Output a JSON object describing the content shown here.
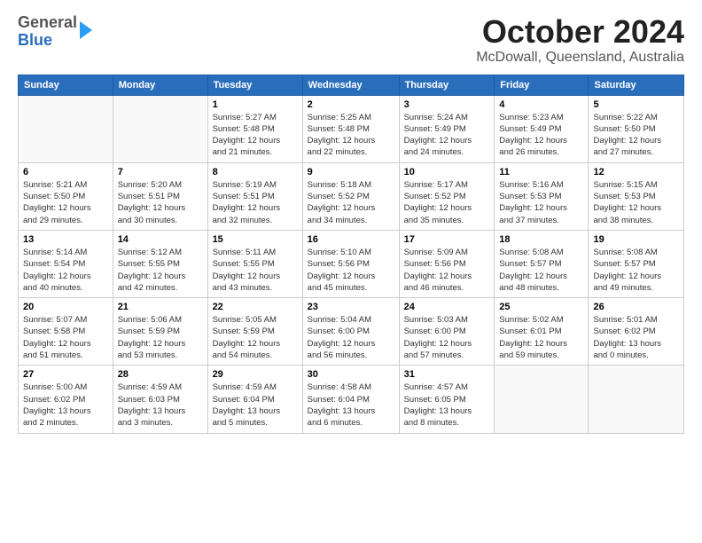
{
  "logo": {
    "general": "General",
    "blue": "Blue"
  },
  "header": {
    "month": "October 2024",
    "location": "McDowall, Queensland, Australia"
  },
  "weekdays": [
    "Sunday",
    "Monday",
    "Tuesday",
    "Wednesday",
    "Thursday",
    "Friday",
    "Saturday"
  ],
  "weeks": [
    [
      {
        "day": "",
        "info": ""
      },
      {
        "day": "",
        "info": ""
      },
      {
        "day": "1",
        "info": "Sunrise: 5:27 AM\nSunset: 5:48 PM\nDaylight: 12 hours\nand 21 minutes."
      },
      {
        "day": "2",
        "info": "Sunrise: 5:25 AM\nSunset: 5:48 PM\nDaylight: 12 hours\nand 22 minutes."
      },
      {
        "day": "3",
        "info": "Sunrise: 5:24 AM\nSunset: 5:49 PM\nDaylight: 12 hours\nand 24 minutes."
      },
      {
        "day": "4",
        "info": "Sunrise: 5:23 AM\nSunset: 5:49 PM\nDaylight: 12 hours\nand 26 minutes."
      },
      {
        "day": "5",
        "info": "Sunrise: 5:22 AM\nSunset: 5:50 PM\nDaylight: 12 hours\nand 27 minutes."
      }
    ],
    [
      {
        "day": "6",
        "info": "Sunrise: 5:21 AM\nSunset: 5:50 PM\nDaylight: 12 hours\nand 29 minutes."
      },
      {
        "day": "7",
        "info": "Sunrise: 5:20 AM\nSunset: 5:51 PM\nDaylight: 12 hours\nand 30 minutes."
      },
      {
        "day": "8",
        "info": "Sunrise: 5:19 AM\nSunset: 5:51 PM\nDaylight: 12 hours\nand 32 minutes."
      },
      {
        "day": "9",
        "info": "Sunrise: 5:18 AM\nSunset: 5:52 PM\nDaylight: 12 hours\nand 34 minutes."
      },
      {
        "day": "10",
        "info": "Sunrise: 5:17 AM\nSunset: 5:52 PM\nDaylight: 12 hours\nand 35 minutes."
      },
      {
        "day": "11",
        "info": "Sunrise: 5:16 AM\nSunset: 5:53 PM\nDaylight: 12 hours\nand 37 minutes."
      },
      {
        "day": "12",
        "info": "Sunrise: 5:15 AM\nSunset: 5:53 PM\nDaylight: 12 hours\nand 38 minutes."
      }
    ],
    [
      {
        "day": "13",
        "info": "Sunrise: 5:14 AM\nSunset: 5:54 PM\nDaylight: 12 hours\nand 40 minutes."
      },
      {
        "day": "14",
        "info": "Sunrise: 5:12 AM\nSunset: 5:55 PM\nDaylight: 12 hours\nand 42 minutes."
      },
      {
        "day": "15",
        "info": "Sunrise: 5:11 AM\nSunset: 5:55 PM\nDaylight: 12 hours\nand 43 minutes."
      },
      {
        "day": "16",
        "info": "Sunrise: 5:10 AM\nSunset: 5:56 PM\nDaylight: 12 hours\nand 45 minutes."
      },
      {
        "day": "17",
        "info": "Sunrise: 5:09 AM\nSunset: 5:56 PM\nDaylight: 12 hours\nand 46 minutes."
      },
      {
        "day": "18",
        "info": "Sunrise: 5:08 AM\nSunset: 5:57 PM\nDaylight: 12 hours\nand 48 minutes."
      },
      {
        "day": "19",
        "info": "Sunrise: 5:08 AM\nSunset: 5:57 PM\nDaylight: 12 hours\nand 49 minutes."
      }
    ],
    [
      {
        "day": "20",
        "info": "Sunrise: 5:07 AM\nSunset: 5:58 PM\nDaylight: 12 hours\nand 51 minutes."
      },
      {
        "day": "21",
        "info": "Sunrise: 5:06 AM\nSunset: 5:59 PM\nDaylight: 12 hours\nand 53 minutes."
      },
      {
        "day": "22",
        "info": "Sunrise: 5:05 AM\nSunset: 5:59 PM\nDaylight: 12 hours\nand 54 minutes."
      },
      {
        "day": "23",
        "info": "Sunrise: 5:04 AM\nSunset: 6:00 PM\nDaylight: 12 hours\nand 56 minutes."
      },
      {
        "day": "24",
        "info": "Sunrise: 5:03 AM\nSunset: 6:00 PM\nDaylight: 12 hours\nand 57 minutes."
      },
      {
        "day": "25",
        "info": "Sunrise: 5:02 AM\nSunset: 6:01 PM\nDaylight: 12 hours\nand 59 minutes."
      },
      {
        "day": "26",
        "info": "Sunrise: 5:01 AM\nSunset: 6:02 PM\nDaylight: 13 hours\nand 0 minutes."
      }
    ],
    [
      {
        "day": "27",
        "info": "Sunrise: 5:00 AM\nSunset: 6:02 PM\nDaylight: 13 hours\nand 2 minutes."
      },
      {
        "day": "28",
        "info": "Sunrise: 4:59 AM\nSunset: 6:03 PM\nDaylight: 13 hours\nand 3 minutes."
      },
      {
        "day": "29",
        "info": "Sunrise: 4:59 AM\nSunset: 6:04 PM\nDaylight: 13 hours\nand 5 minutes."
      },
      {
        "day": "30",
        "info": "Sunrise: 4:58 AM\nSunset: 6:04 PM\nDaylight: 13 hours\nand 6 minutes."
      },
      {
        "day": "31",
        "info": "Sunrise: 4:57 AM\nSunset: 6:05 PM\nDaylight: 13 hours\nand 8 minutes."
      },
      {
        "day": "",
        "info": ""
      },
      {
        "day": "",
        "info": ""
      }
    ]
  ]
}
